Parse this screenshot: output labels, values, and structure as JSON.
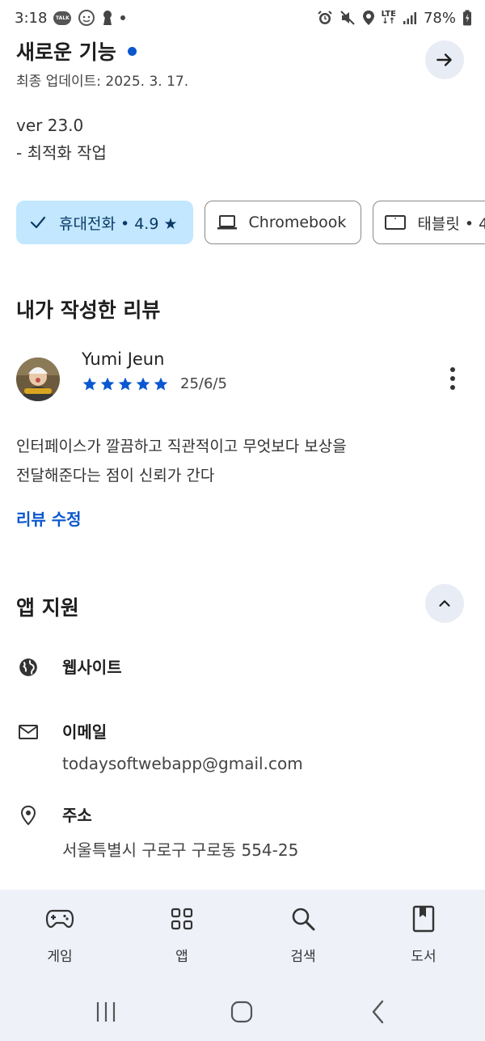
{
  "status_bar": {
    "time": "3:18",
    "talk_label": "TALK",
    "battery": "78%",
    "network": "LTE"
  },
  "whats_new": {
    "title": "새로운 기능",
    "updated": "최종 업데이트: 2025. 3. 17.",
    "version": "ver 23.0",
    "notes": "- 최적화 작업"
  },
  "device_chips": [
    {
      "label": "휴대전화 • 4.9",
      "star": "★",
      "selected": true,
      "icon": "check-icon"
    },
    {
      "label": "Chromebook",
      "selected": false,
      "icon": "laptop-icon"
    },
    {
      "label": "태블릿 • 4",
      "selected": false,
      "icon": "tablet-icon"
    }
  ],
  "my_review": {
    "section_title": "내가 작성한 리뷰",
    "reviewer": "Yumi Jeun",
    "rating": 5,
    "date": "25/6/5",
    "text_line1": "인터페이스가 깔끔하고 직관적이고 무엇보다 보상을",
    "text_line2": "전달해준다는 점이 신뢰가 간다",
    "edit_label": "리뷰 수정"
  },
  "app_support": {
    "section_title": "앱 지원",
    "website_label": "웹사이트",
    "email_label": "이메일",
    "email_value": "todaysoftwebapp@gmail.com",
    "address_label": "주소",
    "address_value": "서울특별시 구로구 구로동 554-25"
  },
  "bottom_nav": [
    {
      "label": "게임",
      "icon": "gamepad-icon"
    },
    {
      "label": "앱",
      "icon": "apps-grid-icon"
    },
    {
      "label": "검색",
      "icon": "search-icon"
    },
    {
      "label": "도서",
      "icon": "book-icon"
    }
  ],
  "colors": {
    "accent": "#0b57d0",
    "chip_selected_bg": "#c2e7ff",
    "nav_bg": "#eef1f8",
    "star": "#0b57d0"
  }
}
